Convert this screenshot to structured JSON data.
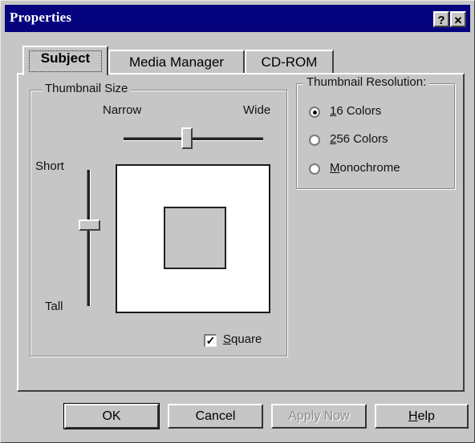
{
  "window": {
    "title": "Properties",
    "help_button": "?",
    "close_button": "✕"
  },
  "tabs": [
    {
      "label": "Subject",
      "active": true
    },
    {
      "label": "Media Manager",
      "active": false
    },
    {
      "label": "CD-ROM",
      "active": false
    }
  ],
  "thumbnail_size": {
    "group_title": "Thumbnail Size",
    "narrow_label": "Narrow",
    "wide_label": "Wide",
    "short_label": "Short",
    "tall_label": "Tall",
    "width_slider_value": 0.45,
    "height_slider_value": 0.4,
    "square_label_prefix": "",
    "square_label_underlined": "S",
    "square_label_rest": "quare",
    "square_checked": true,
    "check_glyph": "✓"
  },
  "thumbnail_resolution": {
    "group_title": "Thumbnail Resolution:",
    "options": [
      {
        "underlined": "1",
        "rest": "6 Colors",
        "selected": true
      },
      {
        "underlined": "2",
        "rest": "56 Colors",
        "selected": false
      },
      {
        "underlined": "M",
        "rest": "onochrome",
        "selected": false
      }
    ]
  },
  "buttons": {
    "ok": "OK",
    "cancel": "Cancel",
    "apply_now": "Apply Now",
    "help_underlined": "H",
    "help_rest": "elp"
  },
  "colors": {
    "titlebar": "#06037e",
    "face": "#c6c6c6"
  }
}
